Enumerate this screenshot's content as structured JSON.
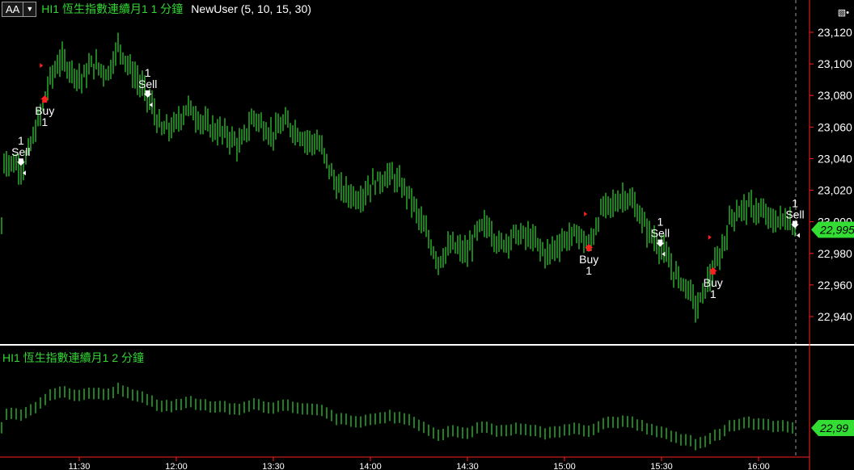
{
  "toolbar": {
    "aa_label": "AA",
    "dropdown_icon": "triangle-down-icon",
    "main_title": "HI1  恆生指數連續月1  1 分鐘",
    "indicator_label": "NewUser (5,  10,  15,  30)",
    "corner_icon": "chart-settings-icon"
  },
  "sub_title": "HI1  恆生指數連續月1  2 分鐘",
  "colors": {
    "background": "#000000",
    "bar": "#33d633",
    "buy_marker": "#ff2020",
    "sell_marker": "#ffffff",
    "price_tag": "#33dd33",
    "divider": "#ffffff",
    "axis_line": "#ff2020"
  },
  "chart_data": [
    {
      "type": "ohlc",
      "title": "HI1  恆生指數連續月1  1 分鐘",
      "xlabel": "",
      "ylabel": "",
      "x_range": [
        "11:10",
        "16:10"
      ],
      "ylim": [
        22932,
        23126
      ],
      "y_ticks": [
        "22,940",
        "22,960",
        "22,980",
        "23,000",
        "23,020",
        "23,040",
        "23,060",
        "23,080",
        "23,100",
        "23,120"
      ],
      "last_price": "22,995",
      "anchors": [
        [
          "11:10",
          23039
        ],
        [
          "11:18",
          23035
        ],
        [
          "11:23",
          23060
        ],
        [
          "11:28",
          23090
        ],
        [
          "11:32",
          23103
        ],
        [
          "11:40",
          23090
        ],
        [
          "11:44",
          23100
        ],
        [
          "11:50",
          23094
        ],
        [
          "11:54",
          23112
        ],
        [
          "11:58",
          23098
        ],
        [
          "12:04",
          23082
        ],
        [
          "12:07",
          23072
        ],
        [
          "12:10",
          23058
        ],
        [
          "12:15",
          23060
        ],
        [
          "12:20",
          23073
        ],
        [
          "12:27",
          23061
        ],
        [
          "12:35",
          23055
        ],
        [
          "12:40",
          23048
        ],
        [
          "12:45",
          23067
        ],
        [
          "12:52",
          23055
        ],
        [
          "12:57",
          23063
        ],
        [
          "13:05",
          23052
        ],
        [
          "13:10",
          23049
        ],
        [
          "13:17",
          23021
        ],
        [
          "13:25",
          23015
        ],
        [
          "13:30",
          23024
        ],
        [
          "13:37",
          23030
        ],
        [
          "13:44",
          23017
        ],
        [
          "13:50",
          22994
        ],
        [
          "13:55",
          22975
        ],
        [
          "14:00",
          22985
        ],
        [
          "14:06",
          22980
        ],
        [
          "14:10",
          22995
        ],
        [
          "14:14",
          22998
        ],
        [
          "14:18",
          22985
        ],
        [
          "14:24",
          22992
        ],
        [
          "14:30",
          22990
        ],
        [
          "14:36",
          22979
        ],
        [
          "14:42",
          22988
        ],
        [
          "14:48",
          22993
        ],
        [
          "14:52",
          22984
        ],
        [
          "14:57",
          23008
        ],
        [
          "15:02",
          23012
        ],
        [
          "15:06",
          23017
        ],
        [
          "15:10",
          23008
        ],
        [
          "15:14",
          22995
        ],
        [
          "15:20",
          22982
        ],
        [
          "15:24",
          22968
        ],
        [
          "15:30",
          22957
        ],
        [
          "15:33",
          22945
        ],
        [
          "15:37",
          22962
        ],
        [
          "15:42",
          22980
        ],
        [
          "15:46",
          23004
        ],
        [
          "15:52",
          23010
        ],
        [
          "15:57",
          23006
        ],
        [
          "16:02",
          23000
        ],
        [
          "16:07",
          23002
        ],
        [
          "16:10",
          22996
        ]
      ],
      "annotations": [
        {
          "kind": "sell",
          "time": "11:17",
          "text": "Sell",
          "qty": "1"
        },
        {
          "kind": "buy",
          "time": "11:26",
          "text": "Buy",
          "qty": "1"
        },
        {
          "kind": "sell",
          "time": "12:05",
          "text": "Sell",
          "qty": "1"
        },
        {
          "kind": "buy",
          "time": "14:52",
          "text": "Buy",
          "qty": "1"
        },
        {
          "kind": "sell",
          "time": "15:19",
          "text": "Sell",
          "qty": "1"
        },
        {
          "kind": "buy",
          "time": "15:39",
          "text": "Buy",
          "qty": "1"
        },
        {
          "kind": "sell",
          "time": "16:10",
          "text": "Sell",
          "qty": "1"
        }
      ]
    },
    {
      "type": "ohlc",
      "title": "HI1  恆生指數連續月1  2 分鐘",
      "xlabel": "",
      "ylabel": "",
      "x_range": [
        "11:10",
        "16:10"
      ],
      "last_price": "22,99",
      "x_ticks": [
        "11:30",
        "12:00",
        "13:30",
        "14:00",
        "14:30",
        "15:00",
        "15:30",
        "16:00"
      ]
    }
  ]
}
